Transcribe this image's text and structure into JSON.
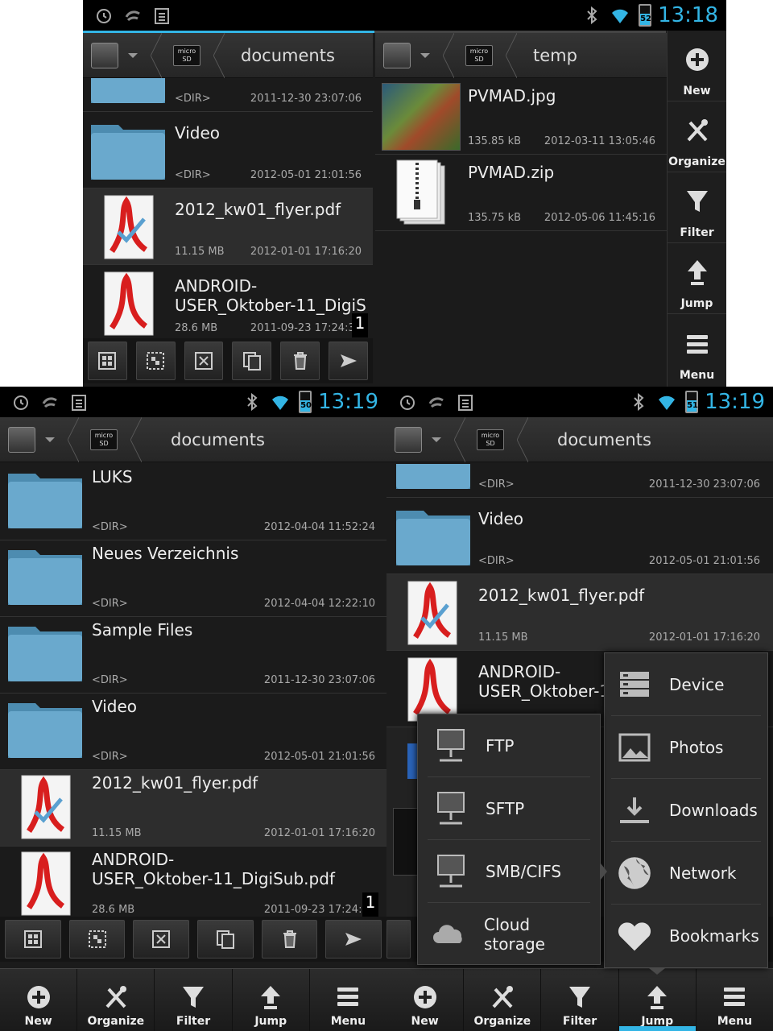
{
  "shots": {
    "top": {
      "clock": "13:18",
      "battery": "52",
      "left_pane": {
        "path": "documents",
        "rows": [
          {
            "name": "",
            "type": "<DIR>",
            "date": "2011-12-30 23:07:06"
          },
          {
            "name": "Video",
            "type": "<DIR>",
            "date": "2012-05-01 21:01:56"
          },
          {
            "name": "2012_kw01_flyer.pdf",
            "type": "11.15 MB",
            "date": "2012-01-01 17:16:20"
          },
          {
            "name": "ANDROID-\nUSER_Oktober-11_DigiS",
            "type": "28.6 MB",
            "date": "2011-09-23 17:24:36"
          }
        ],
        "scroll_indicator": "1"
      },
      "right_pane": {
        "path": "temp",
        "rows": [
          {
            "name": "PVMAD.jpg",
            "type": "135.85 kB",
            "date": "2012-03-11 13:05:46"
          },
          {
            "name": "PVMAD.zip",
            "type": "135.75 kB",
            "date": "2012-05-06 11:45:16"
          }
        ]
      },
      "sidebar": [
        "New",
        "Organize",
        "Filter",
        "Jump",
        "Menu"
      ]
    },
    "bottom_left": {
      "clock": "13:19",
      "battery": "50",
      "path": "documents",
      "rows": [
        {
          "name": "LUKS",
          "type": "<DIR>",
          "date": "2012-04-04 11:52:24"
        },
        {
          "name": "Neues Verzeichnis",
          "type": "<DIR>",
          "date": "2012-04-04 12:22:10"
        },
        {
          "name": "Sample Files",
          "type": "<DIR>",
          "date": "2011-12-30 23:07:06"
        },
        {
          "name": "Video",
          "type": "<DIR>",
          "date": "2012-05-01 21:01:56"
        },
        {
          "name": "2012_kw01_flyer.pdf",
          "type": "11.15 MB",
          "date": "2012-01-01 17:16:20"
        },
        {
          "name": "ANDROID-\nUSER_Oktober-11_DigiSub.pdf",
          "type": "28.6 MB",
          "date": "2011-09-23 17:24:36"
        }
      ],
      "scroll_indicator": "1",
      "bottom": [
        "New",
        "Organize",
        "Filter",
        "Jump",
        "Menu"
      ]
    },
    "bottom_right": {
      "clock": "13:19",
      "battery": "51",
      "path": "documents",
      "rows": [
        {
          "name": "",
          "type": "<DIR>",
          "date": "2011-12-30 23:07:06"
        },
        {
          "name": "Video",
          "type": "<DIR>",
          "date": "2012-05-01 21:01:56"
        },
        {
          "name": "2012_kw01_flyer.pdf",
          "type": "11.15 MB",
          "date": "2012-01-01 17:16:20"
        },
        {
          "name": "ANDROID-\nUSER_Oktober-1",
          "type": "",
          "date": ""
        }
      ],
      "jump_menu": [
        "Device",
        "Photos",
        "Downloads",
        "Network",
        "Bookmarks"
      ],
      "network_menu": [
        "FTP",
        "SFTP",
        "SMB/CIFS",
        "Cloud storage"
      ],
      "bottom": [
        "New",
        "Organize",
        "Filter",
        "Jump",
        "Menu"
      ],
      "active_bottom": "Jump"
    }
  },
  "colors": {
    "accent": "#33b5e5",
    "folder": "#5fa0c4",
    "pdf_red": "#d81e1e"
  }
}
